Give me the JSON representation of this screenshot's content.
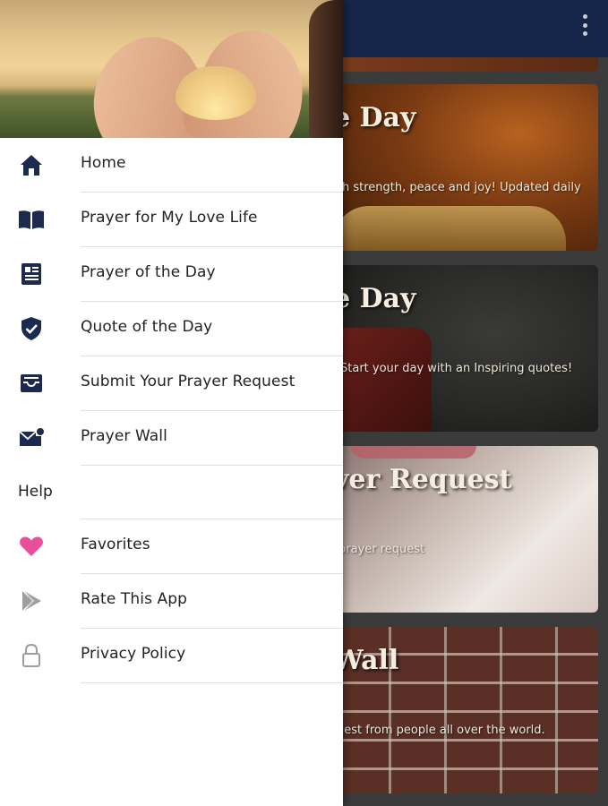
{
  "app_bar": {
    "overflow_icon": "more-vert-icon"
  },
  "cards": [
    {
      "title": "",
      "subtitle": ""
    },
    {
      "title": "e Day",
      "subtitle": "h strength, peace and joy! Updated daily"
    },
    {
      "title": "e Day",
      "subtitle": "Start your day with an Inspiring quotes!"
    },
    {
      "title": "ver Request",
      "subtitle": "prayer request"
    },
    {
      "title": "Wall",
      "subtitle": "uest from people all over the world."
    }
  ],
  "drawer": {
    "items": [
      {
        "label": "Home",
        "icon": "home-icon"
      },
      {
        "label": "Prayer for My Love Life",
        "icon": "book-open-icon"
      },
      {
        "label": "Prayer of the Day",
        "icon": "newspaper-icon"
      },
      {
        "label": "Quote of the Day",
        "icon": "verified-shield-icon"
      },
      {
        "label": "Submit Your Prayer Request",
        "icon": "inbox-icon"
      },
      {
        "label": "Prayer Wall",
        "icon": "mail-notification-icon"
      }
    ],
    "section_label": "Help",
    "help_items": [
      {
        "label": "Favorites",
        "icon": "heart-icon"
      },
      {
        "label": "Rate This App",
        "icon": "play-store-icon"
      },
      {
        "label": "Privacy Policy",
        "icon": "lock-icon"
      }
    ]
  },
  "colors": {
    "app_bar": "#16264a",
    "icon_primary": "#1b2a4e",
    "heart": "#e84f9a",
    "icon_muted": "#9e9e9e"
  }
}
